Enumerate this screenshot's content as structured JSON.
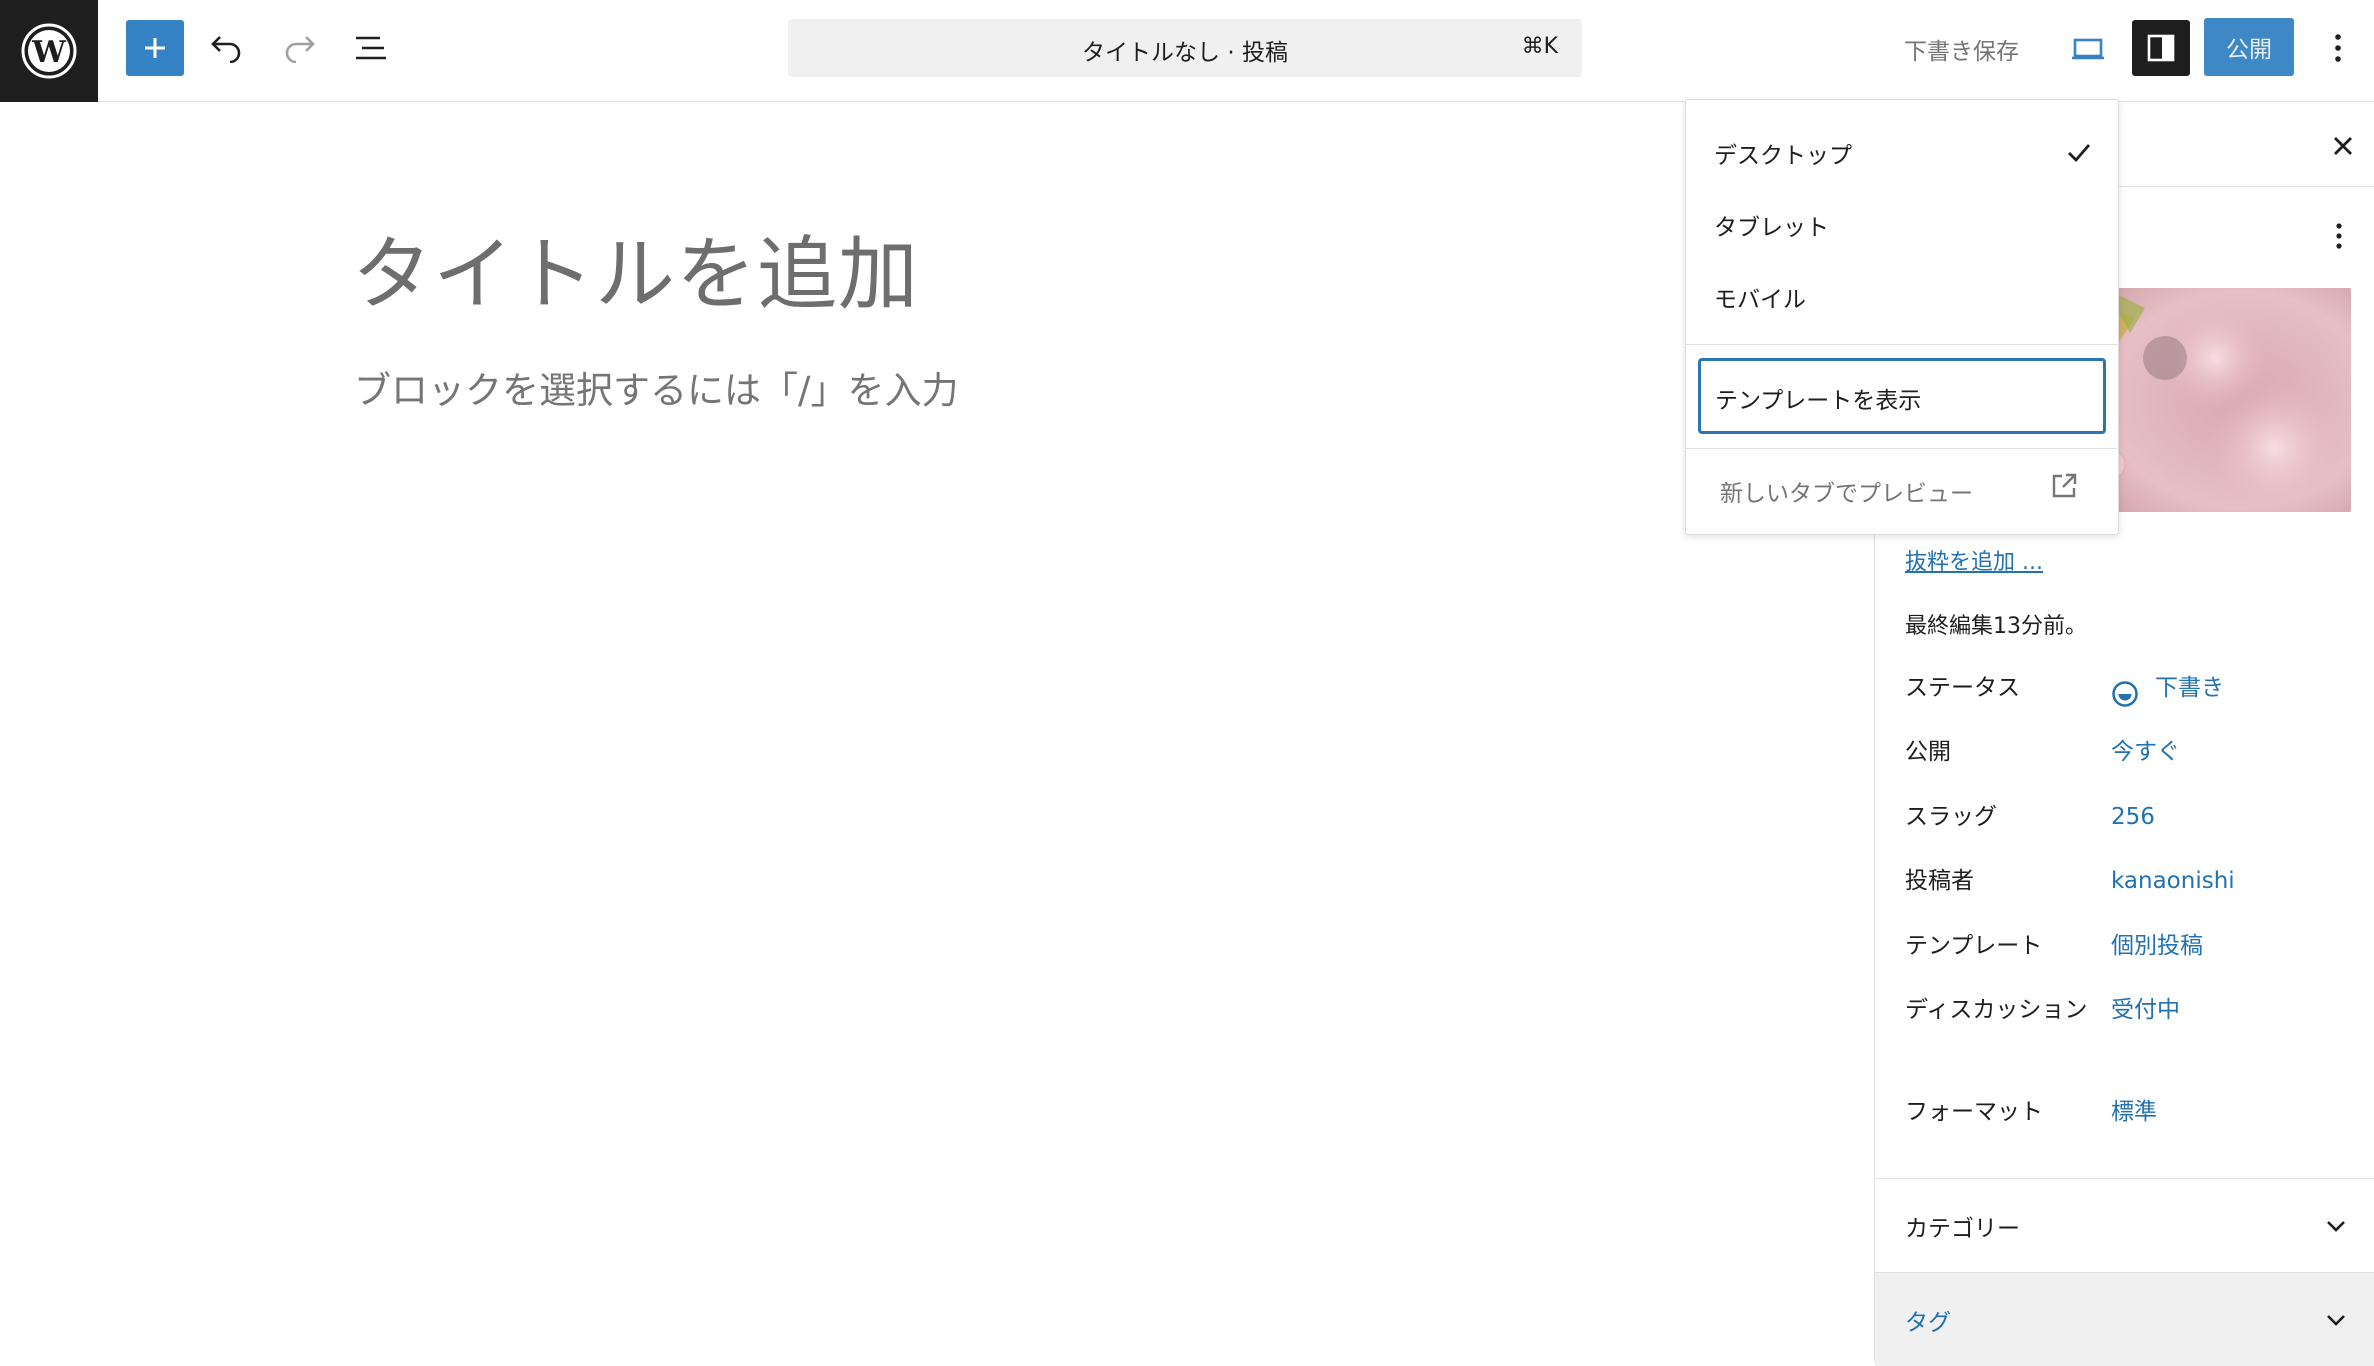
{
  "toolbar": {
    "wp_logo": "wordpress-logo",
    "inserter_icon": "plus-icon",
    "undo_icon": "undo-icon",
    "redo_icon": "redo-icon",
    "list_view_icon": "list-view-icon",
    "command_bar": {
      "title": "タイトルなし · 投稿",
      "shortcut": "⌘K"
    },
    "save_draft": "下書き保存",
    "preview_icon": "desktop-icon",
    "settings_icon": "sidebar-icon",
    "publish": "公開",
    "options_icon": "vertical-ellipsis-icon"
  },
  "editor": {
    "title_placeholder": "タイトルを追加",
    "block_placeholder": "ブロックを選択するには「/」を入力"
  },
  "preview_menu": {
    "items": [
      {
        "label": "デスクトップ",
        "checked": true
      },
      {
        "label": "タブレット",
        "checked": false
      },
      {
        "label": "モバイル",
        "checked": false
      }
    ],
    "show_template": "テンプレートを表示",
    "preview_new_tab": "新しいタブでプレビュー"
  },
  "sidebar": {
    "excerpt_link": "抜粋を追加 ...",
    "last_edited": "最終編集13分前。",
    "meta": [
      {
        "label": "ステータス",
        "value": "下書き"
      },
      {
        "label": "公開",
        "value": "今すぐ"
      },
      {
        "label": "スラッグ",
        "value": "256"
      },
      {
        "label": "投稿者",
        "value": "kanaonishi"
      },
      {
        "label": "テンプレート",
        "value": "個別投稿"
      },
      {
        "label": "ディスカッション",
        "value": "受付中"
      },
      {
        "label": "フォーマット",
        "value": "標準"
      }
    ],
    "panels": [
      {
        "label": "カテゴリー"
      },
      {
        "label": "タグ"
      }
    ]
  },
  "colors": {
    "accent": "#3582c4",
    "link": "#2271b1",
    "dark": "#1e1e1e"
  }
}
